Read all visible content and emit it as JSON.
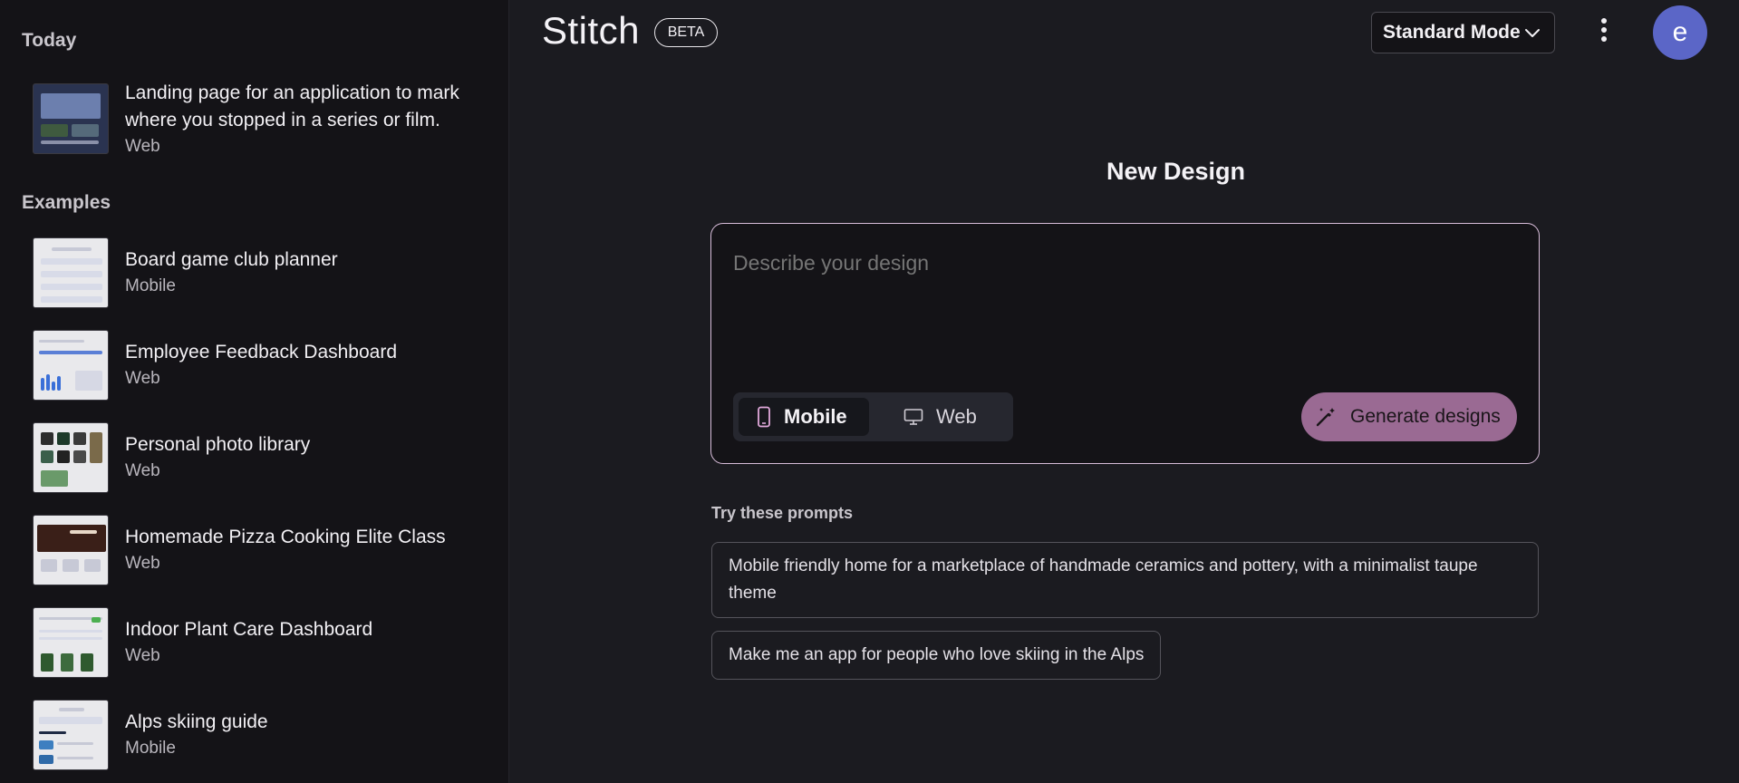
{
  "sidebar": {
    "sections": [
      {
        "title": "Today"
      },
      {
        "title": "Examples"
      }
    ],
    "today": [
      {
        "title": "Landing page for an application to mark where you stopped in a series or film.",
        "sub": "Web"
      }
    ],
    "examples": [
      {
        "title": "Board game club planner",
        "sub": "Mobile"
      },
      {
        "title": "Employee Feedback Dashboard",
        "sub": "Web"
      },
      {
        "title": "Personal photo library",
        "sub": "Web"
      },
      {
        "title": "Homemade Pizza Cooking Elite Class",
        "sub": "Web"
      },
      {
        "title": "Indoor Plant Care Dashboard",
        "sub": "Web"
      },
      {
        "title": "Alps skiing guide",
        "sub": "Mobile"
      }
    ]
  },
  "header": {
    "logo": "Stitch",
    "badge": "BETA",
    "mode_label": "Standard Mode",
    "avatar_letter": "e"
  },
  "main": {
    "title": "New Design",
    "prompt_placeholder": "Describe your design",
    "segments": {
      "mobile": "Mobile",
      "web": "Web"
    },
    "generate_label": "Generate designs",
    "try_label": "Try these prompts",
    "prompts": [
      "Mobile friendly home for a marketplace of handmade ceramics and pottery, with a minimalist taupe theme",
      "Make me an app for people who love skiing in the Alps"
    ]
  },
  "colors": {
    "accent": "#9a6a93",
    "composer_border": "#d7bcd9",
    "avatar": "#5b66c7"
  }
}
